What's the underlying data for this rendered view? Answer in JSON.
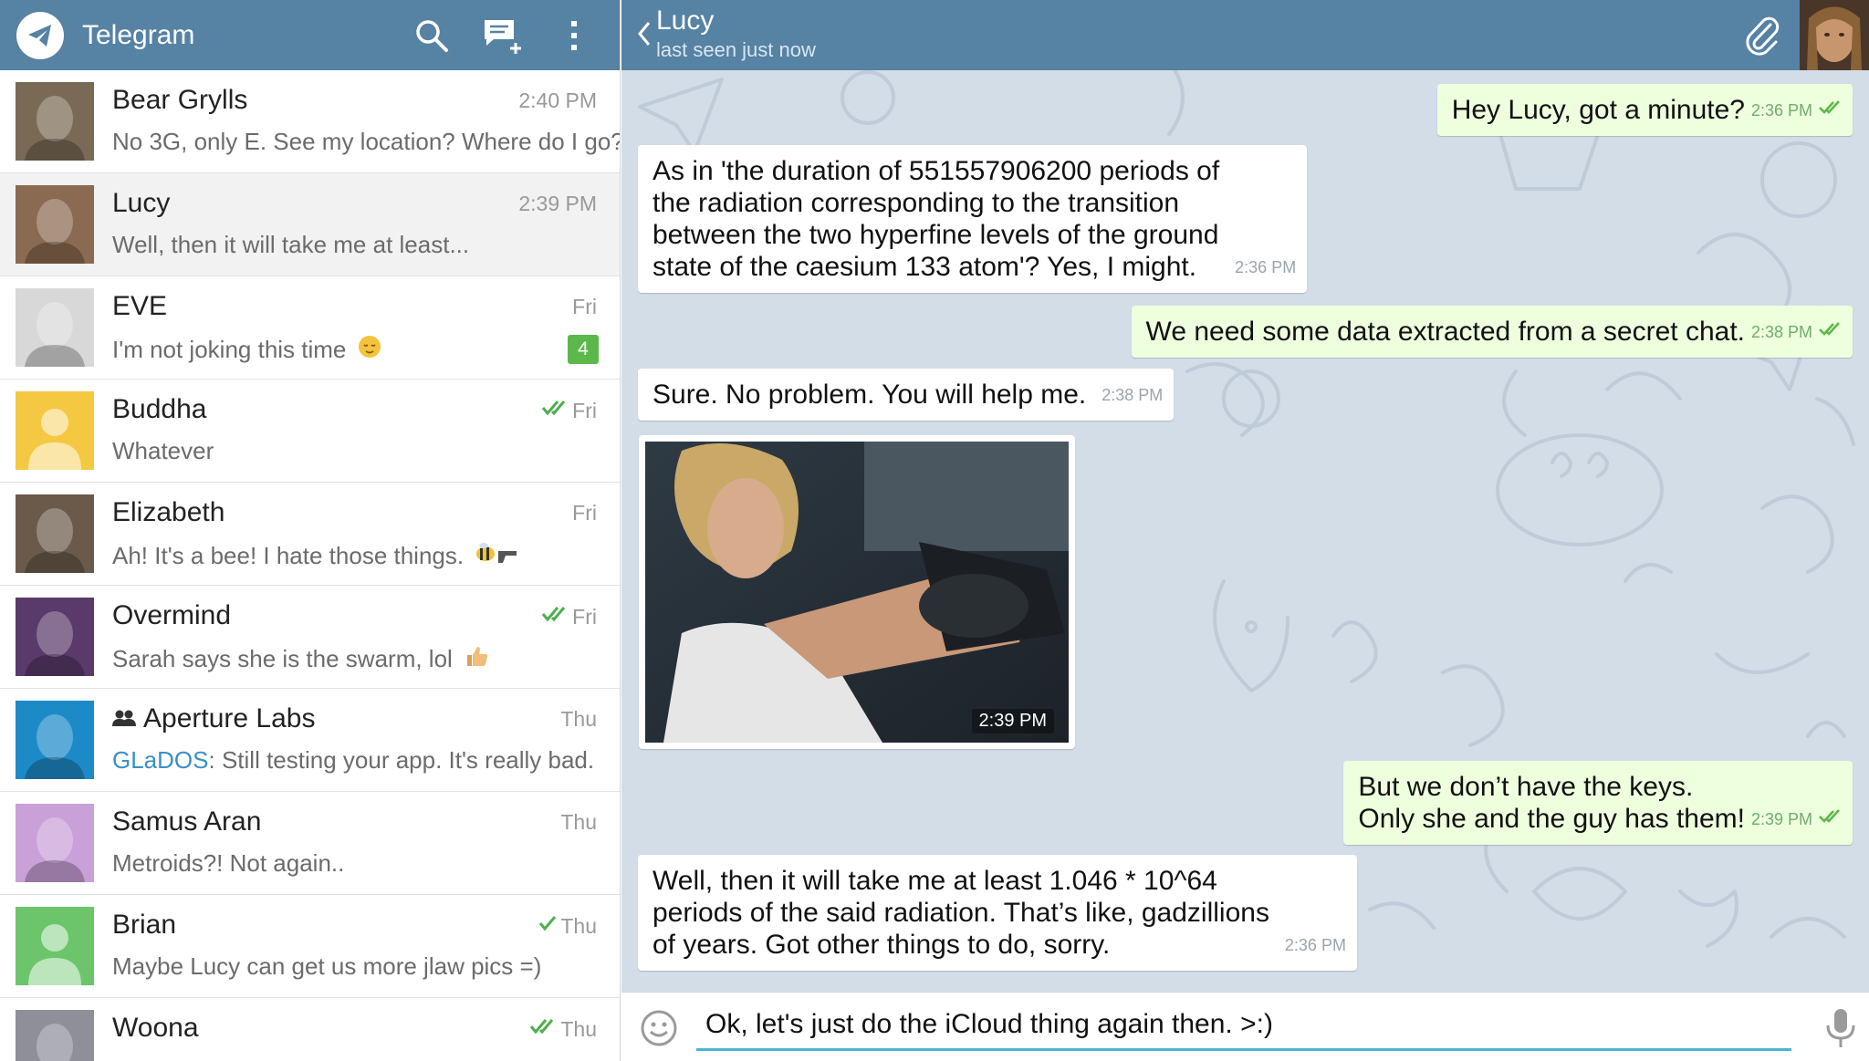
{
  "app": {
    "title": "Telegram"
  },
  "left_header": {
    "icons": [
      "telegram-logo-icon",
      "search-icon",
      "compose-icon",
      "more-vertical-icon"
    ]
  },
  "chats": [
    {
      "name": "Bear Grylls",
      "time": "2:40 PM",
      "preview": "No 3G, only E. See my location? Where do I go?",
      "avatar_color": "#7a6a55",
      "ticks": "",
      "unread": "",
      "emoji": ""
    },
    {
      "name": "Lucy",
      "time": "2:39 PM",
      "preview": "Well, then it will take me at least...",
      "avatar_color": "#8a6a50",
      "ticks": "",
      "unread": "",
      "emoji": "",
      "active": true
    },
    {
      "name": "EVE",
      "time": "Fri",
      "preview": "I'm not joking this time",
      "avatar_color": "#d8d8d8",
      "ticks": "",
      "unread": "4",
      "emoji": "relieved-face-icon"
    },
    {
      "name": "Buddha",
      "time": "Fri",
      "preview": "Whatever",
      "avatar_color": "#f5c842",
      "ticks": "double",
      "unread": "",
      "emoji": ""
    },
    {
      "name": "Elizabeth",
      "time": "Fri",
      "preview": "Ah! It's a bee! I hate those things.",
      "avatar_color": "#6b5a4a",
      "ticks": "",
      "unread": "",
      "emoji": "bee-gun-icon"
    },
    {
      "name": "Overmind",
      "time": "Fri",
      "preview": "Sarah says she is the swarm, lol",
      "avatar_color": "#5a3a6a",
      "ticks": "double",
      "unread": "",
      "emoji": "thumbs-up-icon"
    },
    {
      "name": "Aperture Labs",
      "time": "Thu",
      "sender": "GLaDOS",
      "preview": ": Still testing your app. It's really bad.",
      "avatar_color": "#1d8ac8",
      "ticks": "",
      "unread": "",
      "emoji": "",
      "group": true
    },
    {
      "name": "Samus Aran",
      "time": "Thu",
      "preview": "Metroids?! Not again..",
      "avatar_color": "#c9a0d8",
      "ticks": "",
      "unread": "",
      "emoji": ""
    },
    {
      "name": "Brian",
      "time": "Thu",
      "preview": "Maybe Lucy can get us more jlaw pics =)",
      "avatar_color": "#6cc56a",
      "ticks": "single",
      "unread": "",
      "emoji": ""
    },
    {
      "name": "Woona",
      "time": "Thu",
      "preview": "",
      "avatar_color": "#8f8f9a",
      "ticks": "double",
      "unread": "",
      "emoji": ""
    }
  ],
  "conversation": {
    "peer_name": "Lucy",
    "peer_status": "last seen just now",
    "messages": [
      {
        "dir": "out",
        "text": "Hey Lucy, got a minute?",
        "time": "2:36 PM"
      },
      {
        "dir": "in",
        "text": "As in 'the duration of 551557906200 periods of\nthe radiation corresponding to the transition\nbetween the two hyperfine levels of the ground\nstate of the caesium 133 atom'? Yes, I might.",
        "time": "2:36 PM"
      },
      {
        "dir": "out",
        "text": "We need some data extracted from a secret chat.",
        "time": "2:38 PM"
      },
      {
        "dir": "in",
        "text": "Sure. No problem. You will help me.",
        "time": "2:38 PM"
      },
      {
        "dir": "in",
        "type": "photo",
        "time": "2:39 PM"
      },
      {
        "dir": "out",
        "text": "But we don’t have the keys.\nOnly she and the guy has them!",
        "time": "2:39 PM"
      },
      {
        "dir": "in",
        "text": "Well, then it will take me at least 1.046 * 10^64\nperiods of the said radiation. That’s like, gadzillions\nof years. Got other things to do, sorry.",
        "time": "2:36 PM"
      }
    ]
  },
  "composer": {
    "value": "Ok, let's just do the iCloud thing again then. >:)"
  },
  "colors": {
    "header": "#5682a3",
    "chat_bg": "#d3dde8",
    "outgoing_bubble": "#eeffde",
    "unread_badge": "#5cb84a",
    "composer_underline": "#4db4d3"
  }
}
